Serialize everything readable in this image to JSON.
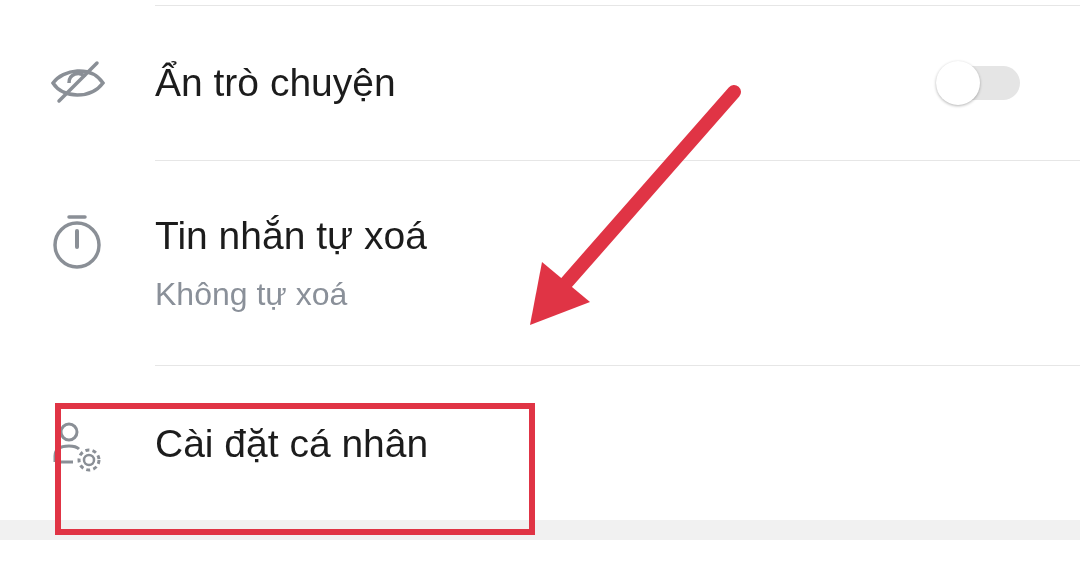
{
  "settings": [
    {
      "kind": "toggle",
      "label": "Ẩn trò chuyện",
      "on": false
    },
    {
      "kind": "subtitle",
      "label": "Tin nhắn tự xoá",
      "subtitle": "Không tự xoá"
    },
    {
      "kind": "plain",
      "label": "Cài đặt cá nhân"
    }
  ]
}
